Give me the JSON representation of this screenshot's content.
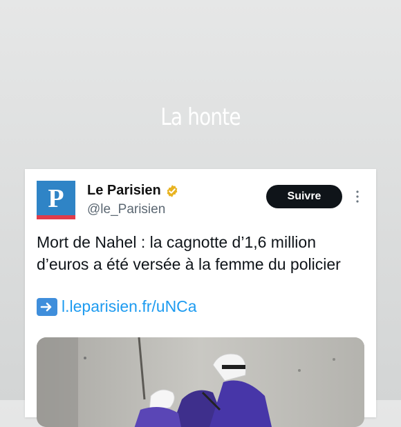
{
  "story": {
    "caption": "La honte"
  },
  "tweet": {
    "account_name": "Le Parisien",
    "handle": "@le_Parisien",
    "logo_letter": "P",
    "follow_label": "Suivre",
    "text": "Mort de Nahel : la cagnotte d’1,6 million d’euros a été versée à la femme du policier",
    "link": "l.leparisien.fr/uNCa",
    "verified": true
  },
  "icons": {
    "verified": "verified-badge-icon",
    "more": "more-vertical-icon",
    "arrow": "right-arrow-emoji-icon"
  },
  "colors": {
    "logo_blue": "#2f84c6",
    "logo_red": "#e03b4a",
    "link_blue": "#1d9bf0",
    "follow_bg": "#0f1419",
    "verified_gold": "#e8b321"
  }
}
